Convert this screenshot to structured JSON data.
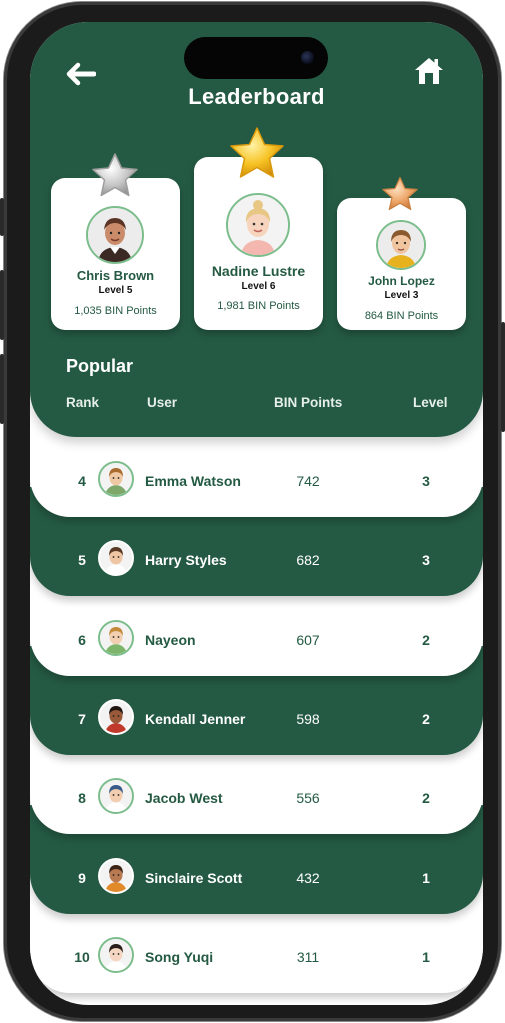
{
  "header": {
    "title": "Leaderboard"
  },
  "top3": [
    {
      "name": "Chris Brown",
      "level": "Level 5",
      "points": "1,035 BIN Points",
      "star": "silver-star-icon"
    },
    {
      "name": "Nadine Lustre",
      "level": "Level 6",
      "points": "1,981 BIN Points",
      "star": "gold-star-icon"
    },
    {
      "name": "John Lopez",
      "level": "Level 3",
      "points": "864 BIN Points",
      "star": "bronze-star-icon"
    }
  ],
  "popular": {
    "title": "Popular",
    "columns": {
      "rank": "Rank",
      "user": "User",
      "points": "BIN Points",
      "level": "Level"
    }
  },
  "rows": [
    {
      "rank": "4",
      "name": "Emma Watson",
      "points": "742",
      "level": "3"
    },
    {
      "rank": "5",
      "name": "Harry Styles",
      "points": "682",
      "level": "3"
    },
    {
      "rank": "6",
      "name": "Nayeon",
      "points": "607",
      "level": "2"
    },
    {
      "rank": "7",
      "name": "Kendall Jenner",
      "points": "598",
      "level": "2"
    },
    {
      "rank": "8",
      "name": "Jacob West",
      "points": "556",
      "level": "2"
    },
    {
      "rank": "9",
      "name": "Sinclaire Scott",
      "points": "432",
      "level": "1"
    },
    {
      "rank": "10",
      "name": "Song Yuqi",
      "points": "311",
      "level": "1"
    }
  ],
  "colors": {
    "primary": "#245a43",
    "accent": "#7cbd8c",
    "gold": "#f5b21c",
    "silver": "#b9b9b9",
    "bronze": "#e8a266"
  }
}
